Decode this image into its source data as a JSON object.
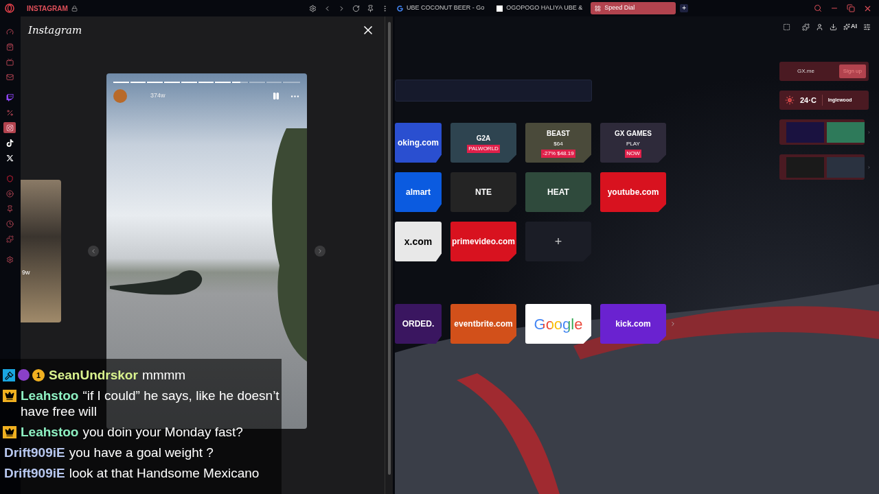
{
  "titlebar": {
    "panel_title": "INSTAGRAM",
    "tabs": [
      {
        "label": "UBE COCONUT BEER - Go",
        "kind": "google",
        "selected": false
      },
      {
        "label": "OGOPOGO HALIYA UBE &",
        "kind": "page",
        "selected": false
      },
      {
        "label": "Speed Dial",
        "kind": "speeddial",
        "selected": true
      }
    ],
    "new_tab": "+"
  },
  "sidebar": {
    "items": [
      {
        "kind": "speed",
        "selected": false
      },
      {
        "kind": "shop",
        "selected": false
      },
      {
        "kind": "tv",
        "selected": false
      },
      {
        "kind": "mail",
        "selected": false
      },
      {
        "kind": "twitch",
        "selected": false
      },
      {
        "kind": "percent",
        "selected": false
      },
      {
        "kind": "instagram",
        "selected": true
      },
      {
        "kind": "tiktok",
        "selected": false
      },
      {
        "kind": "x",
        "selected": false
      },
      {
        "kind": "vpn",
        "selected": false
      },
      {
        "kind": "player",
        "selected": false
      },
      {
        "kind": "pin",
        "selected": false
      },
      {
        "kind": "history",
        "selected": false
      },
      {
        "kind": "extensions",
        "selected": false
      },
      {
        "kind": "settings",
        "selected": false
      }
    ]
  },
  "panel": {
    "logo": "Instagram",
    "preview": {
      "age": "9w"
    },
    "story": {
      "age": "374w",
      "progress": {
        "level": 0.68
      }
    }
  },
  "chat": [
    {
      "badges": [
        {
          "kind": "moderator"
        },
        {
          "kind": "emote"
        },
        {
          "kind": "count",
          "label": "1"
        }
      ],
      "user": "SeanUndrskor",
      "color": "#d9f28e",
      "text": "mmmm"
    },
    {
      "badges": [
        {
          "kind": "crown"
        }
      ],
      "user": "Leahstoo",
      "color": "#8ef0c2",
      "text": "“if I could” he says, like he doesn’t have free will"
    },
    {
      "badges": [
        {
          "kind": "crown"
        }
      ],
      "user": "Leahstoo",
      "color": "#8ef0c2",
      "text": "you doin your Monday fast?"
    },
    {
      "user": "Drift909iE",
      "color": "#b8c8f0",
      "text": "you have a goal weight ?"
    },
    {
      "user": "Drift909iE",
      "color": "#b8c8f0",
      "text": "look at that Handsome Mexicano"
    }
  ],
  "toolbar": {
    "ai_label": "AI"
  },
  "speed_dial": {
    "tiles": [
      {
        "kind": "text",
        "label": "oking.com",
        "color": "#2a4fd0"
      },
      {
        "kind": "promo",
        "lines": [
          "G2A",
          "PALWORLD"
        ],
        "color": "#2e4450"
      },
      {
        "kind": "promo",
        "lines": [
          "BEAST",
          "$64",
          "-27% $48.19"
        ],
        "color": "#4a4a3a"
      },
      {
        "kind": "promo",
        "lines": [
          "GX GAMES",
          "PLAY",
          "NOW"
        ],
        "color": "#2e2a3a"
      },
      {
        "kind": "text",
        "label": "almart",
        "color": "#0b5be0"
      },
      {
        "kind": "text",
        "label": "NTE",
        "color": "#242424"
      },
      {
        "kind": "text",
        "label": "HEAT",
        "color": "#2f4a3c"
      },
      {
        "kind": "text",
        "label": "youtube.com",
        "color": "#d8121f"
      },
      {
        "kind": "light",
        "label": "x.com",
        "color": "#e8e8e8"
      },
      {
        "kind": "text",
        "label": "primevideo.com",
        "color": "#d8121f"
      },
      {
        "kind": "add",
        "label": "+",
        "color": "#1b1d26"
      },
      {
        "kind": "gap"
      },
      {
        "kind": "text",
        "label": "ORDED.",
        "color": "#3a1660"
      },
      {
        "kind": "text",
        "label": "eventbrite.com",
        "color": "#d2501a"
      },
      {
        "kind": "google",
        "label": "Google",
        "color": "#ffffff"
      },
      {
        "kind": "text",
        "label": "kick.com",
        "color": "#6a22d0"
      }
    ],
    "widgets": {
      "account": {
        "name": "GX.me",
        "action": "Sign up"
      },
      "weather": {
        "temp": "24·C",
        "city": "Inglewood"
      }
    }
  }
}
